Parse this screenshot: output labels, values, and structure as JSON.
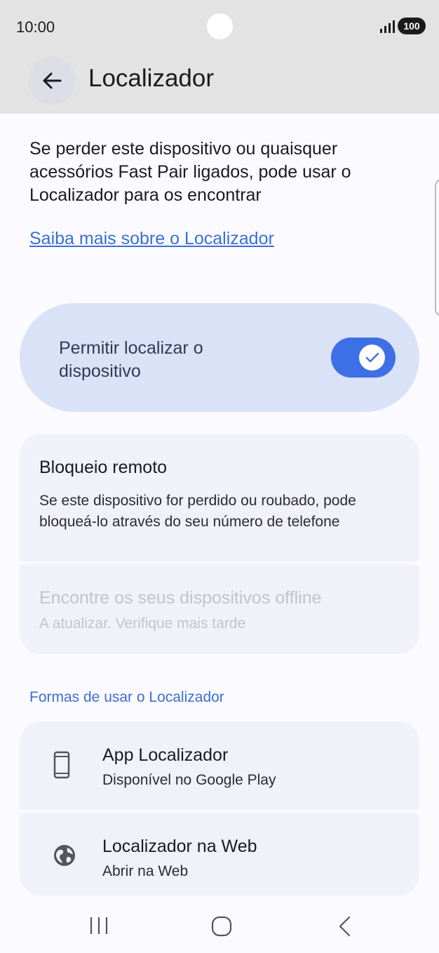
{
  "status_bar": {
    "time": "10:00",
    "battery": "100",
    "signal_icon": "signal-bars-icon"
  },
  "header": {
    "title": "Localizador",
    "back_icon": "arrow-left-icon"
  },
  "intro": {
    "description": "Se perder este dispositivo ou quaisquer acessórios Fast Pair ligados, pode usar o Localizador para os encontrar",
    "link": "Saiba mais sobre o Localizador"
  },
  "toggle": {
    "label": "Permitir localizar o dispositivo",
    "enabled": true
  },
  "remote_lock": {
    "title": "Bloqueio remoto",
    "subtitle": "Se este dispositivo for perdido ou roubado, pode bloqueá-lo através do seu número de telefone"
  },
  "offline": {
    "title": "Encontre os seus dispositivos offline",
    "subtitle": "A atualizar. Verifique mais tarde"
  },
  "ways_section": {
    "header": "Formas de usar o Localizador",
    "items": [
      {
        "title": "App Localizador",
        "subtitle": "Disponível no Google Play",
        "icon": "phone-icon"
      },
      {
        "title": "Localizador na Web",
        "subtitle": "Abrir na Web",
        "icon": "globe-icon"
      }
    ]
  },
  "colors": {
    "accent": "#3d70e6",
    "link": "#3b6fd4",
    "toggle_card": "#dae2f8",
    "card": "#f1f2f9",
    "header_bg": "#e3e3e3"
  }
}
